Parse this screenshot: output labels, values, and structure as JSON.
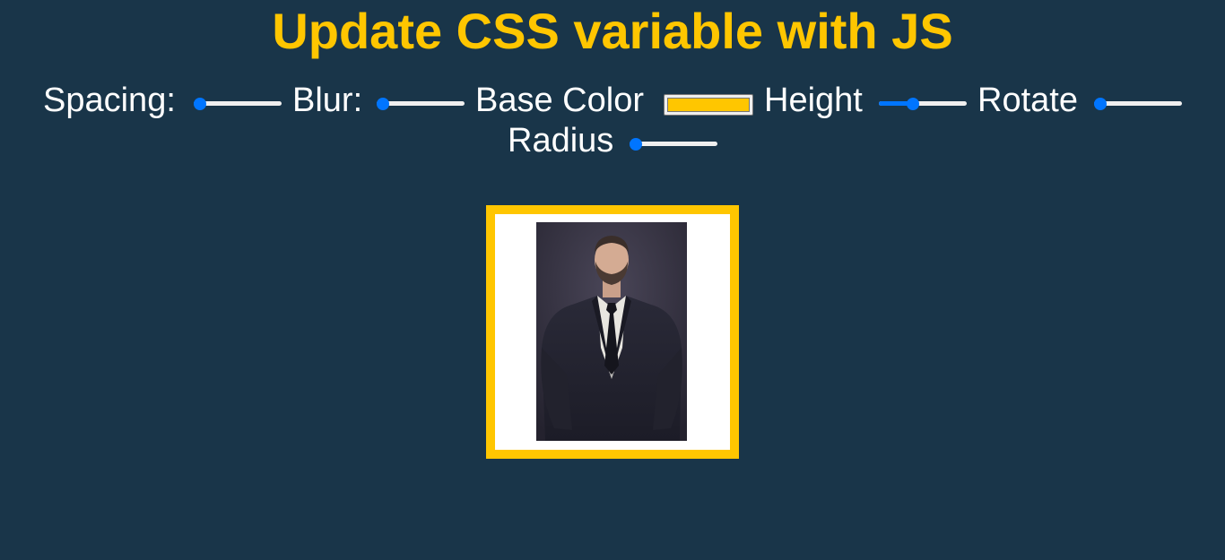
{
  "heading": "Update CSS variable with JS",
  "colors": {
    "background": "#193549",
    "accent": "#ffc600",
    "slider_accent": "#0075ff"
  },
  "controls": [
    {
      "name": "spacing",
      "label": "Spacing:",
      "type": "range",
      "value_fraction": 0.0
    },
    {
      "name": "blur",
      "label": "Blur:",
      "type": "range",
      "value_fraction": 0.0
    },
    {
      "name": "base-color",
      "label": "Base Color",
      "type": "color",
      "value": "#ffc600"
    },
    {
      "name": "height",
      "label": "Height",
      "type": "range",
      "value_fraction": 0.37
    },
    {
      "name": "rotate",
      "label": "Rotate",
      "type": "range",
      "value_fraction": 0.0
    },
    {
      "name": "radius",
      "label": "Radius",
      "type": "range",
      "value_fraction": 0.0
    }
  ],
  "image": {
    "subject": "portrait photo of a bearded man in a dark suit and tie"
  }
}
